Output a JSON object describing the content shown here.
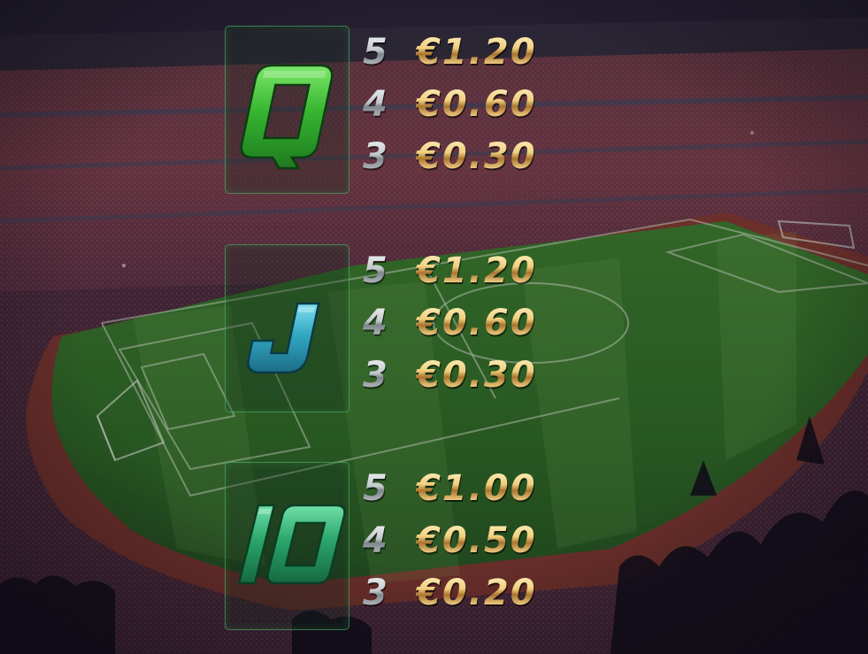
{
  "colors": {
    "gold": "#e0b55c",
    "silver": "#cfd3d6",
    "frame": "#5ac86e",
    "pitch": "#2f7a2a"
  },
  "paytable": [
    {
      "symbol": "Q",
      "symbol_color": "#3fbf3c",
      "payouts": [
        {
          "count": "5",
          "amount": "€1.20"
        },
        {
          "count": "4",
          "amount": "€0.60"
        },
        {
          "count": "3",
          "amount": "€0.30"
        }
      ]
    },
    {
      "symbol": "J",
      "symbol_color": "#2fa9c4",
      "payouts": [
        {
          "count": "5",
          "amount": "€1.20"
        },
        {
          "count": "4",
          "amount": "€0.60"
        },
        {
          "count": "3",
          "amount": "€0.30"
        }
      ]
    },
    {
      "symbol": "10",
      "symbol_color": "#27a56a",
      "payouts": [
        {
          "count": "5",
          "amount": "€1.00"
        },
        {
          "count": "4",
          "amount": "€0.50"
        },
        {
          "count": "3",
          "amount": "€0.20"
        }
      ]
    }
  ]
}
